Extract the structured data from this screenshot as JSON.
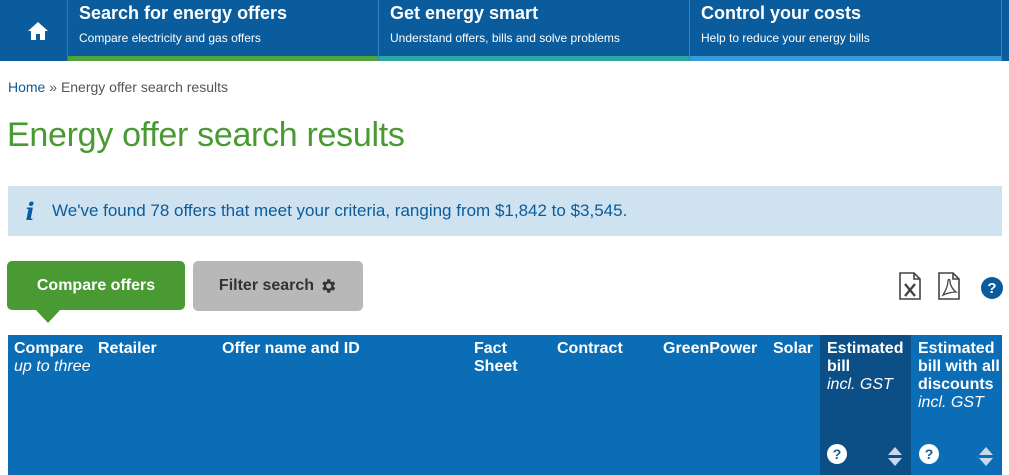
{
  "nav": {
    "tabs": [
      {
        "title": "Search for energy offers",
        "subtitle": "Compare electricity and gas offers"
      },
      {
        "title": "Get energy smart",
        "subtitle": "Understand offers, bills and solve problems"
      },
      {
        "title": "Control your costs",
        "subtitle": "Help to reduce your energy bills"
      }
    ]
  },
  "breadcrumb": {
    "home": "Home",
    "separator": "»",
    "current": "Energy offer search results"
  },
  "page_title": "Energy offer search results",
  "info": {
    "icon": "i",
    "message": "We've found 78 offers that meet your criteria, ranging from $1,842 to $3,545."
  },
  "buttons": {
    "compare": "Compare offers",
    "filter": "Filter search"
  },
  "tools": {
    "help": "?"
  },
  "table": {
    "compare": {
      "label": "Compare",
      "sub": "up to three"
    },
    "retailer": "Retailer",
    "offer": "Offer name and ID",
    "fact": "Fact Sheet",
    "contract": "Contract",
    "greenpower": "GreenPower",
    "solar": "Solar",
    "estimated": {
      "label": "Estimated bill",
      "sub": "incl. GST"
    },
    "estimated_discounts": {
      "label": "Estimated bill with all discounts",
      "sub": "incl. GST"
    },
    "help": "?"
  },
  "colors": {
    "nav": "#0a5c9c",
    "green": "#4a9a33",
    "info_bg": "#cfe2f0",
    "table_head": "#0a6db5",
    "table_head_dark": "#0b4f86"
  }
}
